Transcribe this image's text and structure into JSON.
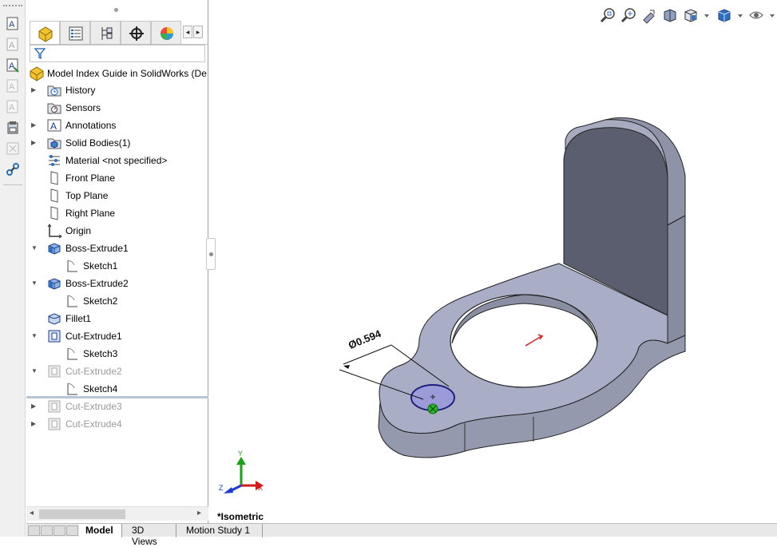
{
  "feature_tree": {
    "root_label": "Model Index Guide in SolidWorks  (De",
    "items": [
      {
        "label": "History",
        "icon": "history-folder-icon",
        "expandable": true,
        "indent": 0,
        "dim": false
      },
      {
        "label": "Sensors",
        "icon": "sensors-folder-icon",
        "expandable": false,
        "indent": 0,
        "dim": false
      },
      {
        "label": "Annotations",
        "icon": "annotations-folder-icon",
        "expandable": true,
        "indent": 0,
        "dim": false
      },
      {
        "label": "Solid Bodies(1)",
        "icon": "solid-bodies-folder-icon",
        "expandable": true,
        "indent": 0,
        "dim": false
      },
      {
        "label": "Material <not specified>",
        "icon": "material-icon",
        "expandable": false,
        "indent": 0,
        "dim": false
      },
      {
        "label": "Front Plane",
        "icon": "plane-icon",
        "expandable": false,
        "indent": 0,
        "dim": false
      },
      {
        "label": "Top Plane",
        "icon": "plane-icon",
        "expandable": false,
        "indent": 0,
        "dim": false
      },
      {
        "label": "Right Plane",
        "icon": "plane-icon",
        "expandable": false,
        "indent": 0,
        "dim": false
      },
      {
        "label": "Origin",
        "icon": "origin-icon",
        "expandable": false,
        "indent": 0,
        "dim": false
      },
      {
        "label": "Boss-Extrude1",
        "icon": "boss-extrude-icon",
        "expandable": true,
        "expanded": true,
        "indent": 0,
        "dim": false
      },
      {
        "label": "Sketch1",
        "icon": "sketch-icon",
        "expandable": false,
        "indent": 1,
        "dim": false
      },
      {
        "label": "Boss-Extrude2",
        "icon": "boss-extrude-icon",
        "expandable": true,
        "expanded": true,
        "indent": 0,
        "dim": false
      },
      {
        "label": "Sketch2",
        "icon": "sketch-icon",
        "expandable": false,
        "indent": 1,
        "dim": false
      },
      {
        "label": "Fillet1",
        "icon": "fillet-icon",
        "expandable": false,
        "indent": 0,
        "dim": false
      },
      {
        "label": "Cut-Extrude1",
        "icon": "cut-extrude-icon",
        "expandable": true,
        "expanded": true,
        "indent": 0,
        "dim": false
      },
      {
        "label": "Sketch3",
        "icon": "sketch-icon",
        "expandable": false,
        "indent": 1,
        "dim": false
      },
      {
        "label": "Cut-Extrude2",
        "icon": "cut-extrude-icon",
        "expandable": true,
        "expanded": true,
        "indent": 0,
        "dim": true
      },
      {
        "label": "Sketch4",
        "icon": "sketch-icon",
        "expandable": false,
        "indent": 1,
        "dim": false
      },
      {
        "label": "Cut-Extrude3",
        "icon": "cut-extrude-icon",
        "expandable": true,
        "indent": 0,
        "dim": true
      },
      {
        "label": "Cut-Extrude4",
        "icon": "cut-extrude-icon",
        "expandable": true,
        "indent": 0,
        "dim": true
      }
    ]
  },
  "bottom_tabs": [
    {
      "label": "Model",
      "active": true
    },
    {
      "label": "3D Views",
      "active": false
    },
    {
      "label": "Motion Study 1",
      "active": false
    }
  ],
  "viewport": {
    "view_name": "*Isometric",
    "dimension_label": "Ø0.594",
    "triad_labels": {
      "x": "X",
      "y": "Y",
      "z": "Z"
    }
  },
  "colors": {
    "part_face": "#a7abc3",
    "part_side": "#9599ad",
    "part_dark": "#6a6d7f",
    "sketch_fill": "#9a9bd8",
    "rollback_bar": "#b9c4d6"
  }
}
